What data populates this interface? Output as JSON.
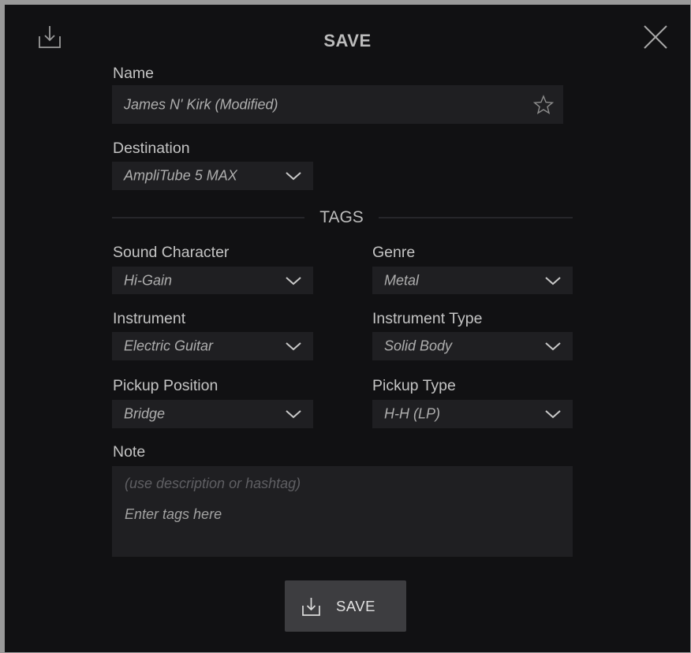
{
  "dialog": {
    "title": "SAVE",
    "icons": {
      "export": "export-icon",
      "close": "close-icon",
      "favorite": "star-icon",
      "dropdown": "chevron-down-icon"
    }
  },
  "name": {
    "label": "Name",
    "value": "James N' Kirk (Modified)"
  },
  "destination": {
    "label": "Destination",
    "value": "AmpliTube 5 MAX"
  },
  "tags": {
    "heading": "TAGS",
    "sound_character": {
      "label": "Sound Character",
      "value": "Hi-Gain"
    },
    "genre": {
      "label": "Genre",
      "value": "Metal"
    },
    "instrument": {
      "label": "Instrument",
      "value": "Electric Guitar"
    },
    "instrument_type": {
      "label": "Instrument Type",
      "value": "Solid Body"
    },
    "pickup_position": {
      "label": "Pickup Position",
      "value": "Bridge"
    },
    "pickup_type": {
      "label": "Pickup Type",
      "value": "H-H (LP)"
    }
  },
  "note": {
    "label": "Note",
    "placeholder": "(use description or hashtag)",
    "input_hint": "Enter tags here"
  },
  "save_button": {
    "label": "SAVE"
  },
  "colors": {
    "background": "#111113",
    "field": "#1f1f22",
    "button": "#3d3d40",
    "text": "#c4c4c4"
  }
}
